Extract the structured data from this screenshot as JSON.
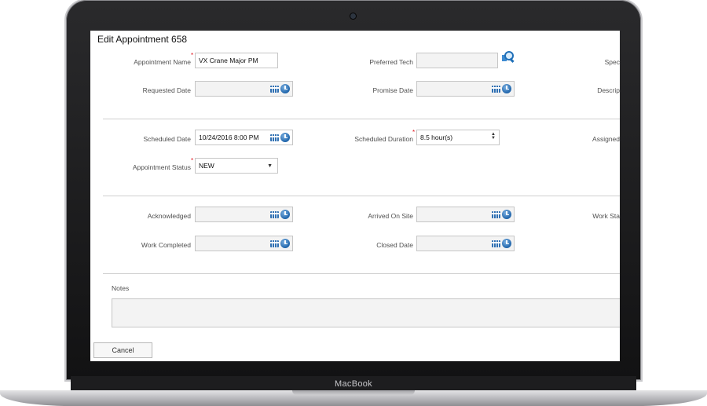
{
  "device": {
    "brand_label": "MacBook"
  },
  "form": {
    "title": "Edit Appointment 658",
    "fields": {
      "appointment_name": {
        "label": "Appointment Name",
        "value": "VX Crane Major PM",
        "required": true
      },
      "preferred_tech": {
        "label": "Preferred Tech",
        "value": ""
      },
      "specialty_partial": {
        "label": "Spec"
      },
      "requested_date": {
        "label": "Requested Date",
        "value": ""
      },
      "promise_date": {
        "label": "Promise Date",
        "value": ""
      },
      "description_partial": {
        "label": "Descrip"
      },
      "scheduled_date": {
        "label": "Scheduled Date",
        "value": "10/24/2016 8:00 PM"
      },
      "scheduled_duration": {
        "label": "Scheduled Duration",
        "value": "8.5 hour(s)",
        "required": true
      },
      "assigned_partial": {
        "label": "Assigned"
      },
      "appointment_status": {
        "label": "Appointment Status",
        "value": "NEW",
        "required": true
      },
      "acknowledged": {
        "label": "Acknowledged",
        "value": ""
      },
      "arrived_on_site": {
        "label": "Arrived On Site",
        "value": ""
      },
      "work_status_partial": {
        "label": "Work Sta"
      },
      "work_completed": {
        "label": "Work Completed",
        "value": ""
      },
      "closed_date": {
        "label": "Closed Date",
        "value": ""
      }
    },
    "notes": {
      "label": "Notes",
      "value": ""
    },
    "cancel_label": "Cancel",
    "required_marker": "*"
  },
  "icons": {
    "calendar": "calendar-icon",
    "clock": "clock-icon",
    "lookup": "lookup-icon"
  },
  "colors": {
    "accent": "#2f6fb2",
    "required": "#e0141e",
    "field_bg": "#f3f3f3",
    "field_border": "#c6c6c6"
  }
}
